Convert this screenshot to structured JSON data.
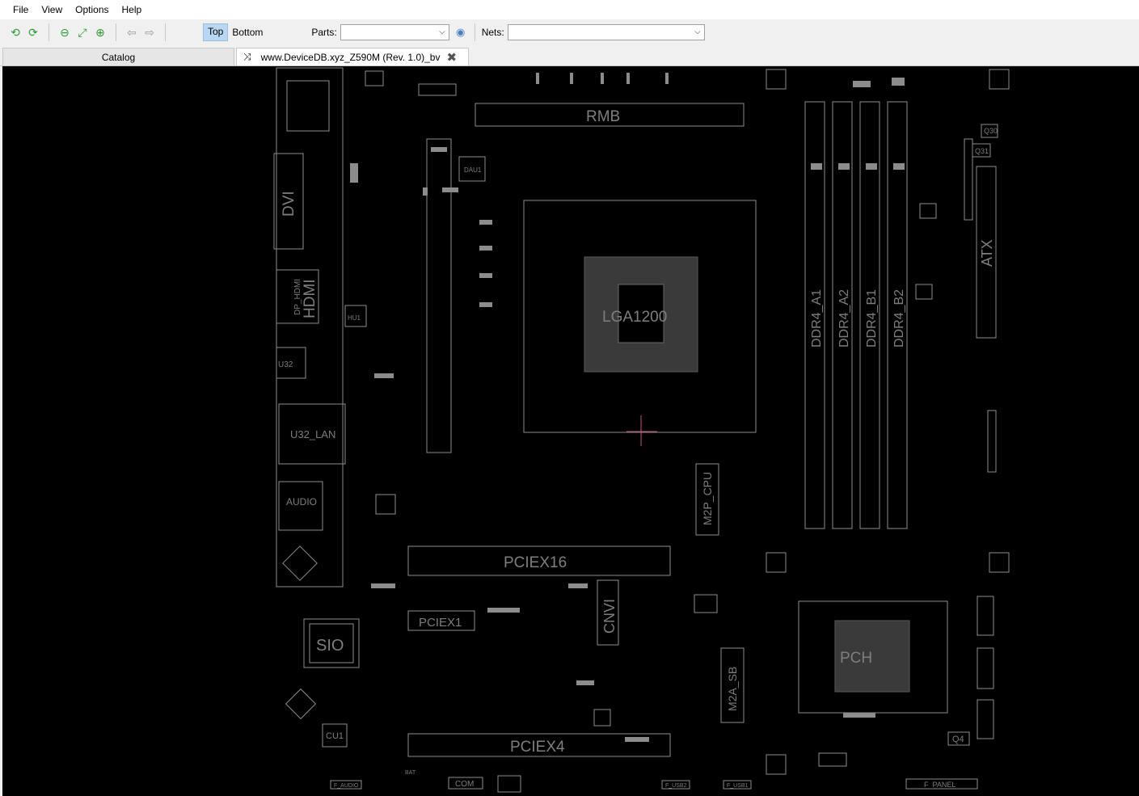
{
  "menu": {
    "file": "File",
    "view": "View",
    "options": "Options",
    "help": "Help"
  },
  "toolbar": {
    "top_label": "Top",
    "bottom_label": "Bottom",
    "parts_label": "Parts:",
    "parts_value": "",
    "nets_label": "Nets:",
    "nets_value": ""
  },
  "tabs": {
    "catalog": "Catalog",
    "document": "www.DeviceDB.xyz_Z590M (Rev. 1.0)_bv"
  },
  "board": {
    "labels": {
      "rmb": "RMB",
      "dvi": "DVI",
      "hdmi": "HDMI",
      "dp_hdmi": "DP_HDMI",
      "usb_label": "U32",
      "u32_lan": "U32_LAN",
      "audio": "AUDIO",
      "dau1": "DAU1",
      "hu1": "HU1",
      "lga": "LGA1200",
      "ddr4_a1": "DDR4_A1",
      "ddr4_a2": "DDR4_A2",
      "ddr4_b1": "DDR4_B1",
      "ddr4_b2": "DDR4_B2",
      "atx": "ATX",
      "q30": "Q30",
      "q31": "Q31",
      "pciex16": "PCIEX16",
      "pciex1": "PCIEX1",
      "pciex4": "PCIEX4",
      "cnvi": "CNVI",
      "m2p_cpu": "M2P_CPU",
      "m2a_sb": "M2A_SB",
      "pch": "PCH",
      "sio": "SIO",
      "cu1": "CU1",
      "q4": "Q4",
      "com": "COM",
      "f_audio": "F_AUDIO",
      "f_usb2": "F_USB2",
      "f_usb1": "F_USB1",
      "f_panel": "F_PANEL",
      "bat": "BAT"
    }
  },
  "colors": {
    "board_bg": "#000000",
    "outline": "#8c8c8c",
    "label": "#7e7e7e",
    "marker": "#c8507a",
    "active_view": "#b9d7f2"
  }
}
